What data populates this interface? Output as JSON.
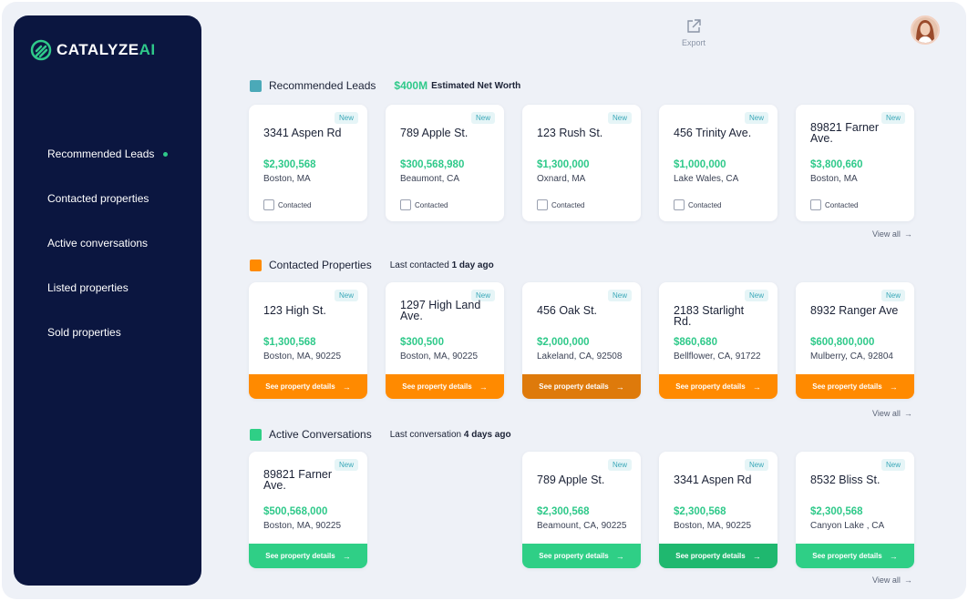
{
  "brand": {
    "name_main": "CATALYZE",
    "name_accent": "AI"
  },
  "sidebar": {
    "items": [
      {
        "label": "Recommended Leads",
        "active": true
      },
      {
        "label": "Contacted properties"
      },
      {
        "label": "Active conversations"
      },
      {
        "label": "Listed properties"
      },
      {
        "label": "Sold properties"
      }
    ]
  },
  "topbar": {
    "export_label": "Export"
  },
  "colors": {
    "recommended": "#4ba9b8",
    "contacted": "#ff8a00",
    "active": "#2fcf86",
    "price": "#2fc98a",
    "sidebar": "#0b1640"
  },
  "recommended": {
    "title": "Recommended Leads",
    "networth_value": "$400M",
    "networth_label": "Estimated Net Worth",
    "badge": "New",
    "checkbox_label": "Contacted",
    "view_all": "View all",
    "cards": [
      {
        "address": "3341 Aspen Rd",
        "price": "$2,300,568",
        "city": "Boston, MA"
      },
      {
        "address": "789 Apple St.",
        "price": "$300,568,980",
        "city": "Beaumont, CA"
      },
      {
        "address": "123 Rush St.",
        "price": "$1,300,000",
        "city": "Oxnard, MA"
      },
      {
        "address": "456 Trinity Ave.",
        "price": "$1,000,000",
        "city": "Lake Wales, CA"
      },
      {
        "address": "89821 Farner Ave.",
        "price": "$3,800,660",
        "city": "Boston, MA"
      }
    ]
  },
  "contacted": {
    "title": "Contacted Properties",
    "meta_prefix": "Last contacted",
    "meta_value": "1 day ago",
    "badge": "New",
    "cta_label": "See property details",
    "view_all": "View all",
    "cards": [
      {
        "address": "123 High St.",
        "price": "$1,300,568",
        "city": "Boston, MA, 90225"
      },
      {
        "address": "1297 High Land Ave.",
        "price": "$300,500",
        "city": "Boston, MA, 90225"
      },
      {
        "address": "456 Oak St.",
        "price": "$2,000,000",
        "city": "Lakeland, CA, 92508"
      },
      {
        "address": "2183 Starlight Rd.",
        "price": "$860,680",
        "city": "Bellflower, CA, 91722"
      },
      {
        "address": "8932 Ranger Ave",
        "price": "$600,800,000",
        "city": "Mulberry, CA, 92804"
      }
    ]
  },
  "active": {
    "title": "Active Conversations",
    "meta_prefix": "Last conversation",
    "meta_value": "4 days ago",
    "badge": "New",
    "cta_label": "See property details",
    "view_all": "View all",
    "cards": [
      {
        "address": "89821 Farner Ave.",
        "price": "$500,568,000",
        "city": "Boston, MA, 90225"
      },
      {
        "address": "789 Apple St.",
        "price": "$2,300,568",
        "city": "Beamount, CA, 90225"
      },
      {
        "address": "3341 Aspen Rd",
        "price": "$2,300,568",
        "city": "Boston, MA, 90225"
      },
      {
        "address": "8532 Bliss St.",
        "price": "$2,300,568",
        "city": "Canyon Lake , CA"
      }
    ]
  }
}
